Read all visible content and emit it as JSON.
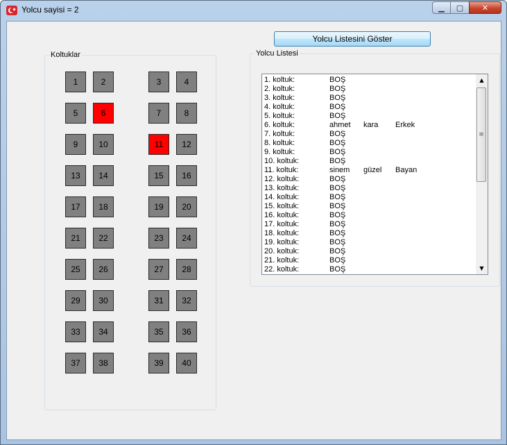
{
  "window": {
    "title": "Yolcu sayisi = 2",
    "icon": "turkish-flag-icon",
    "controls": {
      "minimize": "▁",
      "maximize": "▢",
      "close": "✕"
    }
  },
  "seats_group": {
    "title": "Koltuklar",
    "seats": [
      {
        "num": "1",
        "occupied": false
      },
      {
        "num": "2",
        "occupied": false
      },
      {
        "num": "3",
        "occupied": false
      },
      {
        "num": "4",
        "occupied": false
      },
      {
        "num": "5",
        "occupied": false
      },
      {
        "num": "6",
        "occupied": true
      },
      {
        "num": "7",
        "occupied": false
      },
      {
        "num": "8",
        "occupied": false
      },
      {
        "num": "9",
        "occupied": false
      },
      {
        "num": "10",
        "occupied": false
      },
      {
        "num": "11",
        "occupied": true
      },
      {
        "num": "12",
        "occupied": false
      },
      {
        "num": "13",
        "occupied": false
      },
      {
        "num": "14",
        "occupied": false
      },
      {
        "num": "15",
        "occupied": false
      },
      {
        "num": "16",
        "occupied": false
      },
      {
        "num": "17",
        "occupied": false
      },
      {
        "num": "18",
        "occupied": false
      },
      {
        "num": "19",
        "occupied": false
      },
      {
        "num": "20",
        "occupied": false
      },
      {
        "num": "21",
        "occupied": false
      },
      {
        "num": "22",
        "occupied": false
      },
      {
        "num": "23",
        "occupied": false
      },
      {
        "num": "24",
        "occupied": false
      },
      {
        "num": "25",
        "occupied": false
      },
      {
        "num": "26",
        "occupied": false
      },
      {
        "num": "27",
        "occupied": false
      },
      {
        "num": "28",
        "occupied": false
      },
      {
        "num": "29",
        "occupied": false
      },
      {
        "num": "30",
        "occupied": false
      },
      {
        "num": "31",
        "occupied": false
      },
      {
        "num": "32",
        "occupied": false
      },
      {
        "num": "33",
        "occupied": false
      },
      {
        "num": "34",
        "occupied": false
      },
      {
        "num": "35",
        "occupied": false
      },
      {
        "num": "36",
        "occupied": false
      },
      {
        "num": "37",
        "occupied": false
      },
      {
        "num": "38",
        "occupied": false
      },
      {
        "num": "39",
        "occupied": false
      },
      {
        "num": "40",
        "occupied": false
      }
    ],
    "colors": {
      "empty": "#808080",
      "occupied": "#ff0000"
    }
  },
  "show_button": {
    "label": "Yolcu Listesini Göster"
  },
  "list_group": {
    "title": "Yolcu Listesi",
    "rows": [
      {
        "seat": "1. koltuk:",
        "name": "BOŞ",
        "surname": "",
        "gender": ""
      },
      {
        "seat": "2. koltuk:",
        "name": "BOŞ",
        "surname": "",
        "gender": ""
      },
      {
        "seat": "3. koltuk:",
        "name": "BOŞ",
        "surname": "",
        "gender": ""
      },
      {
        "seat": "4. koltuk:",
        "name": "BOŞ",
        "surname": "",
        "gender": ""
      },
      {
        "seat": "5. koltuk:",
        "name": "BOŞ",
        "surname": "",
        "gender": ""
      },
      {
        "seat": "6. koltuk:",
        "name": "ahmet",
        "surname": "kara",
        "gender": "Erkek"
      },
      {
        "seat": "7. koltuk:",
        "name": "BOŞ",
        "surname": "",
        "gender": ""
      },
      {
        "seat": "8. koltuk:",
        "name": "BOŞ",
        "surname": "",
        "gender": ""
      },
      {
        "seat": "9. koltuk:",
        "name": "BOŞ",
        "surname": "",
        "gender": ""
      },
      {
        "seat": "10. koltuk:",
        "name": "BOŞ",
        "surname": "",
        "gender": ""
      },
      {
        "seat": "11. koltuk:",
        "name": "sinem",
        "surname": "güzel",
        "gender": "Bayan"
      },
      {
        "seat": "12. koltuk:",
        "name": "BOŞ",
        "surname": "",
        "gender": ""
      },
      {
        "seat": "13. koltuk:",
        "name": "BOŞ",
        "surname": "",
        "gender": ""
      },
      {
        "seat": "14. koltuk:",
        "name": "BOŞ",
        "surname": "",
        "gender": ""
      },
      {
        "seat": "15. koltuk:",
        "name": "BOŞ",
        "surname": "",
        "gender": ""
      },
      {
        "seat": "16. koltuk:",
        "name": "BOŞ",
        "surname": "",
        "gender": ""
      },
      {
        "seat": "17. koltuk:",
        "name": "BOŞ",
        "surname": "",
        "gender": ""
      },
      {
        "seat": "18. koltuk:",
        "name": "BOŞ",
        "surname": "",
        "gender": ""
      },
      {
        "seat": "19. koltuk:",
        "name": "BOŞ",
        "surname": "",
        "gender": ""
      },
      {
        "seat": "20. koltuk:",
        "name": "BOŞ",
        "surname": "",
        "gender": ""
      },
      {
        "seat": "21. koltuk:",
        "name": "BOŞ",
        "surname": "",
        "gender": ""
      },
      {
        "seat": "22. koltuk:",
        "name": "BOŞ",
        "surname": "",
        "gender": ""
      }
    ],
    "scrollbar": {
      "up": "▲",
      "down": "▼",
      "grip": "≡"
    }
  }
}
